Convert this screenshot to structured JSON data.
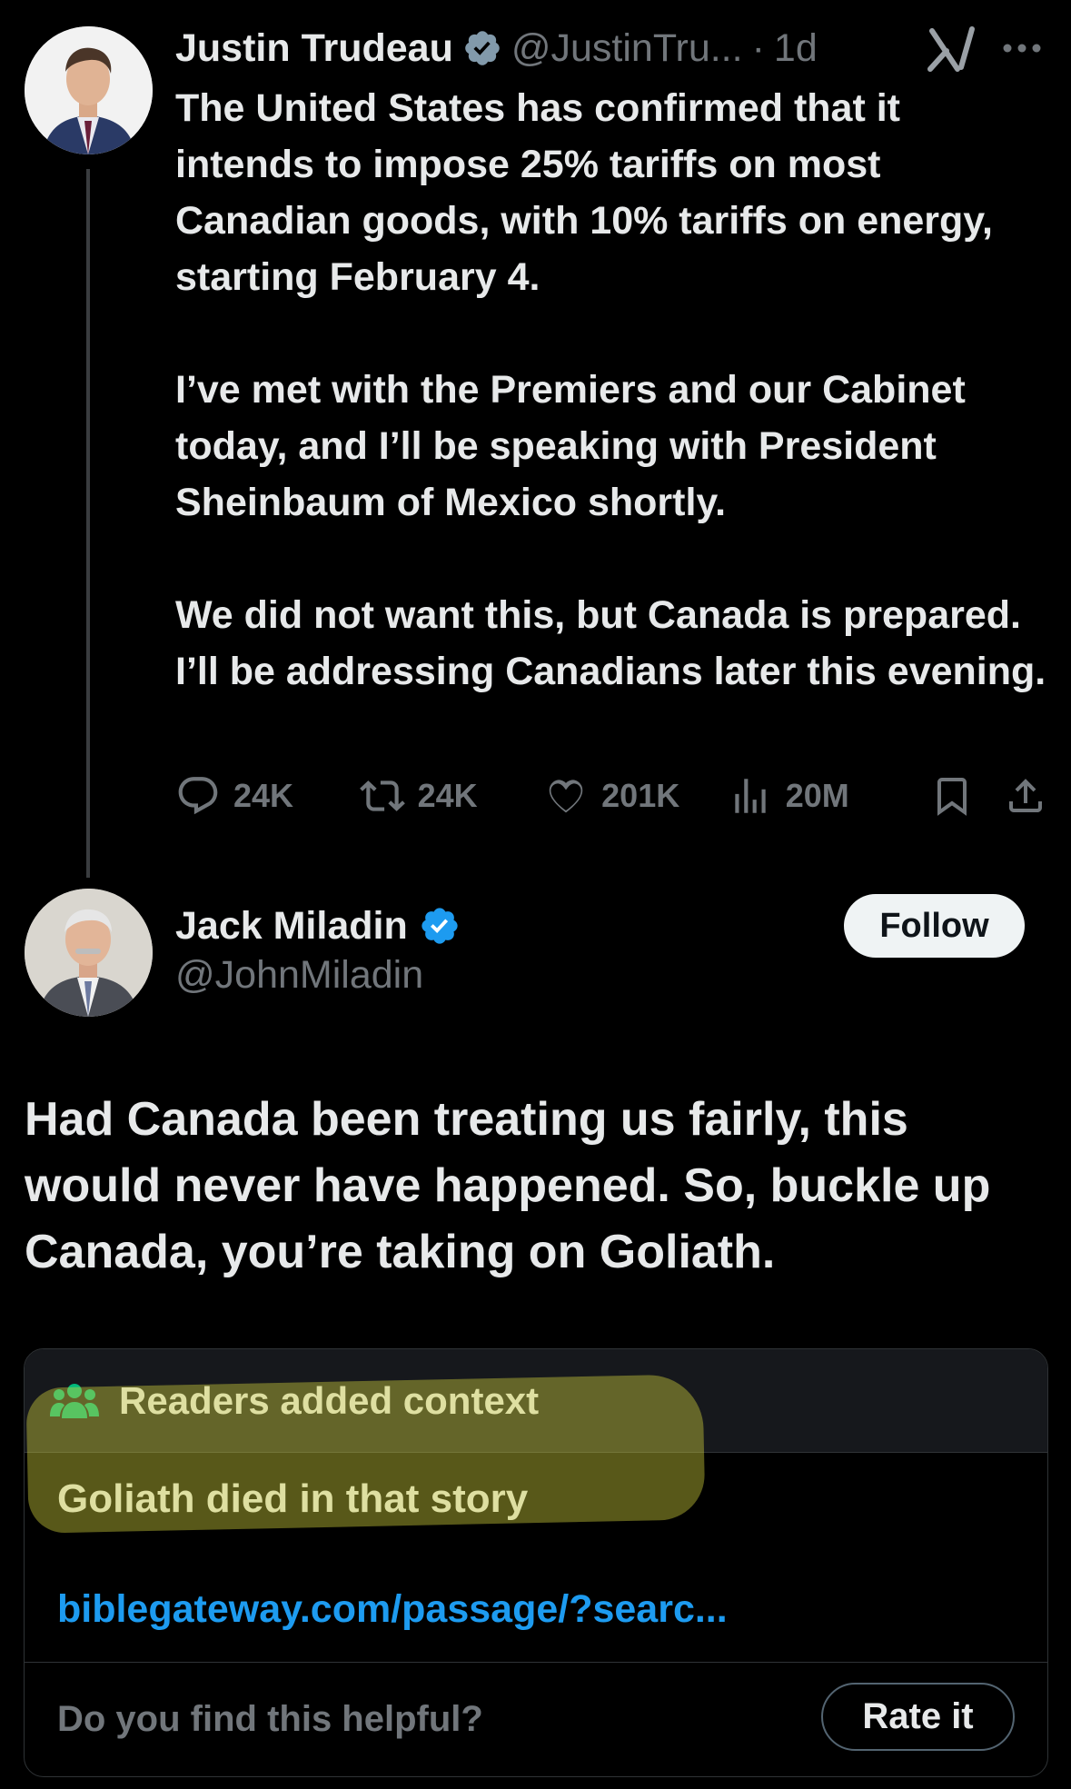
{
  "original_tweet": {
    "author_name": "Justin Trudeau",
    "handle": "@JustinTru...",
    "separator": "·",
    "time_ago": "1d",
    "paragraphs": [
      "The United States has confirmed that it intends to impose 25% tariffs on most Canadian goods, with 10% tariffs on energy, starting February 4.",
      "I’ve met with the Premiers and our Cabinet today, and I’ll be speaking with President Sheinbaum of Mexico shortly.",
      "We did not want this, but Canada is prepared. I’ll be addressing Canadians later this evening."
    ],
    "stats": {
      "replies": "24K",
      "reposts": "24K",
      "likes": "201K",
      "views": "20M"
    }
  },
  "reply_tweet": {
    "author_name": "Jack Miladin",
    "handle": "@JohnMiladin",
    "follow_label": "Follow",
    "text": "Had Canada been treating us fairly, this would never have happened. So, buckle up Canada, you’re taking on Goliath."
  },
  "community_note": {
    "title": "Readers added context",
    "body": "Goliath died in that story",
    "link": "biblegateway.com/passage/?searc...",
    "question": "Do you find this helpful?",
    "rate_label": "Rate it"
  },
  "colors": {
    "background": "#000000",
    "text_primary": "#e7e9ea",
    "text_secondary": "#71767b",
    "verified_blue": "#1d9bf0",
    "verified_gov_gray": "#829aab",
    "note_icon_green": "#00ba7c",
    "highlight": "#d2d23c"
  },
  "icons": [
    "verified-badge-icon",
    "grok-icon",
    "more-icon",
    "reply-icon",
    "repost-icon",
    "like-icon",
    "views-icon",
    "bookmark-icon",
    "share-icon",
    "people-icon"
  ]
}
